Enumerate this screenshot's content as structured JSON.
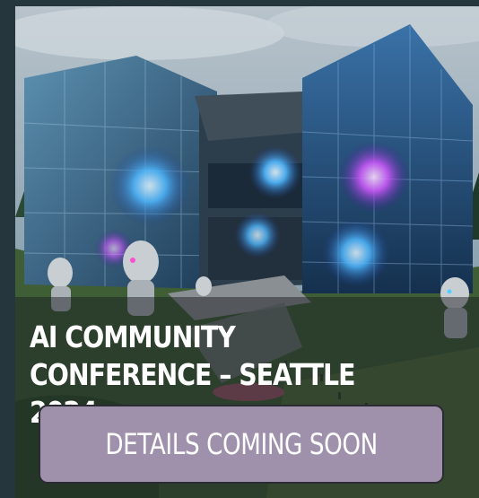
{
  "card": {
    "title": "AI COMMUNITY CONFERENCE – SEATTLE 2024",
    "image_alt": "Glass-walled futuristic conference building with holographic AI displays and humanoid robots in a forested landscape",
    "details_button_label": "DETAILS COMING SOON"
  },
  "colors": {
    "page_background": "#26363d",
    "button_fill": "#9f91ab",
    "button_border": "#2b2b33",
    "title_text": "#ffffff",
    "overlay": "rgba(25,30,34,0.48)"
  }
}
